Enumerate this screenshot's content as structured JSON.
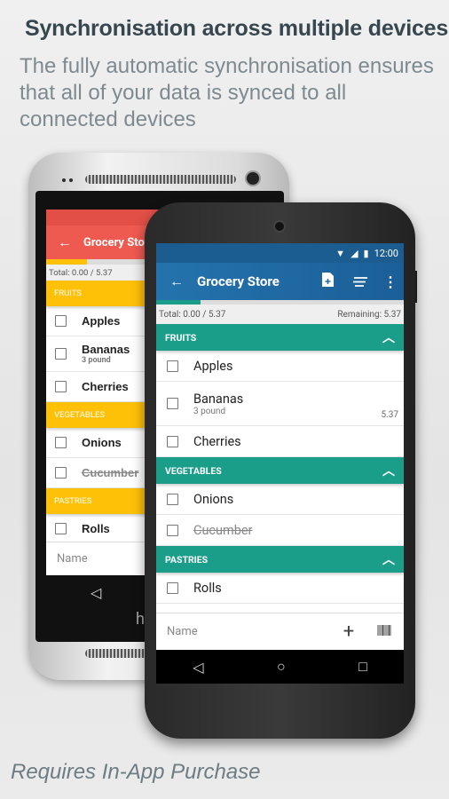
{
  "headline": "Synchronisation across multiple devices",
  "subtitle": "The fully automatic synchronisation ensures that all of your data is synced to all connected devices",
  "footer": "Requires In-App Purchase",
  "status": {
    "time": "12:00"
  },
  "toolbar": {
    "title": "Grocery Store",
    "back_icon": "arrow-left-icon",
    "icons": [
      "add-document-icon",
      "sort-icon",
      "more-vert-icon"
    ]
  },
  "totals": {
    "total": "Total: 0.00 / 5.37",
    "remaining": "Remaining: 5.37"
  },
  "progress_fraction": 0.18,
  "sections": [
    {
      "title": "FRUITS",
      "items": [
        {
          "name": "Apples"
        },
        {
          "name": "Bananas",
          "qty": "3 pound",
          "price": "5.37"
        },
        {
          "name": "Cherries"
        }
      ]
    },
    {
      "title": "VEGETABLES",
      "items": [
        {
          "name": "Onions"
        },
        {
          "name": "Cucumber",
          "done": true
        }
      ]
    },
    {
      "title": "PASTRIES",
      "items": [
        {
          "name": "Rolls"
        }
      ]
    }
  ],
  "input": {
    "placeholder": "Name"
  },
  "brand_logo": "htc",
  "colors": {
    "front_toolbar": "#2473ad",
    "front_section": "#1a9e8a",
    "back_toolbar": "#ef5a50",
    "back_section": "#ffc107"
  }
}
